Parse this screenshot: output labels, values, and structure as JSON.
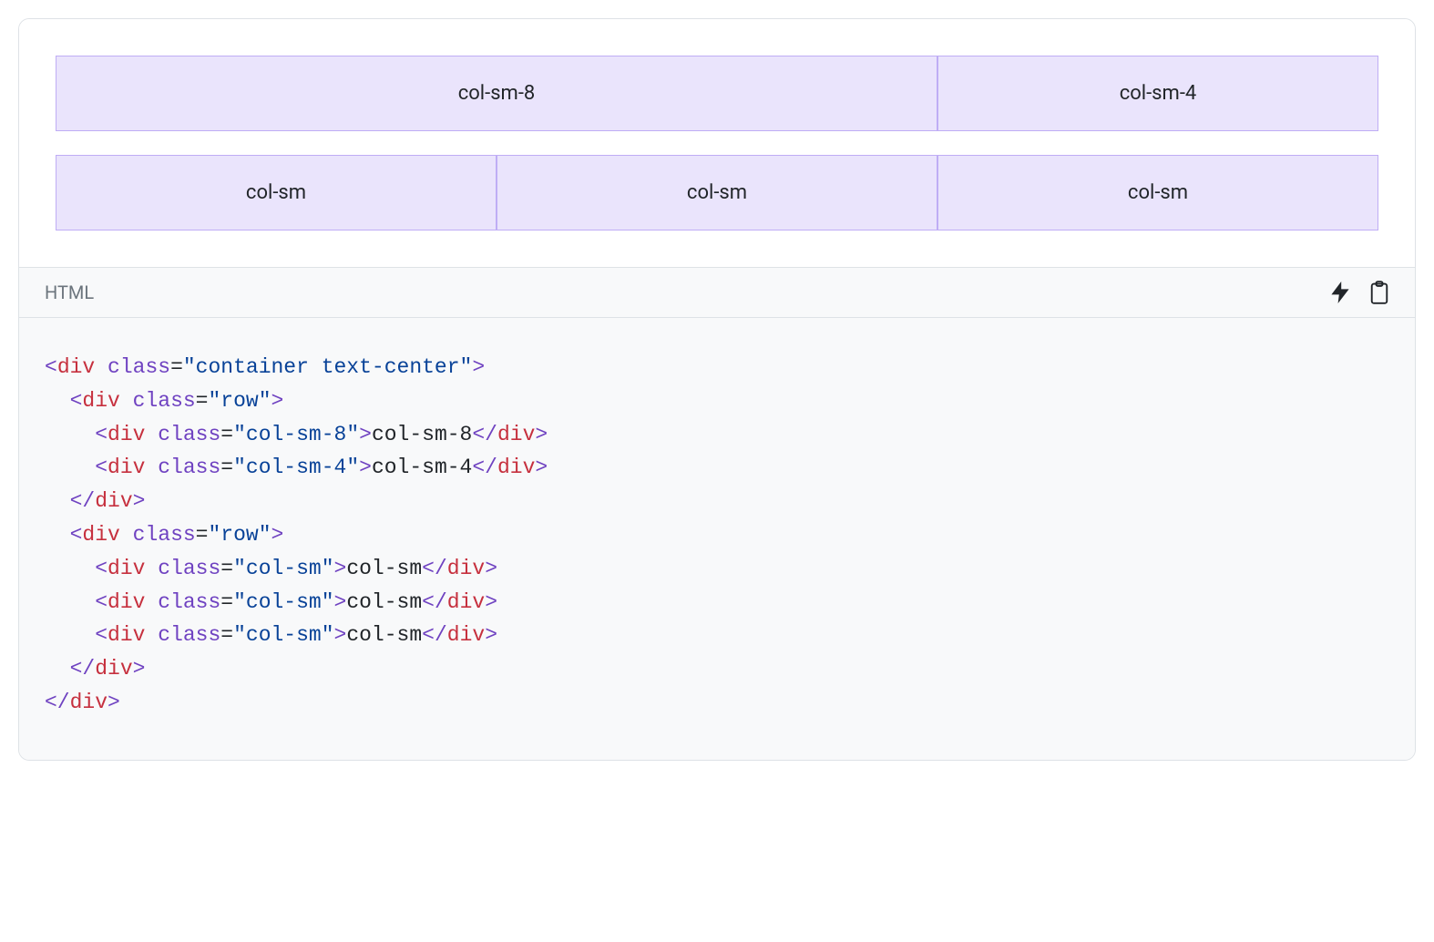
{
  "example": {
    "rows": [
      {
        "cols": [
          {
            "label": "col-sm-8",
            "width": "w8"
          },
          {
            "label": "col-sm-4",
            "width": "w4"
          }
        ]
      },
      {
        "cols": [
          {
            "label": "col-sm",
            "width": "weq"
          },
          {
            "label": "col-sm",
            "width": "weq"
          },
          {
            "label": "col-sm",
            "width": "weq"
          }
        ]
      }
    ]
  },
  "code_header": {
    "language_label": "HTML"
  },
  "code": {
    "lines": [
      {
        "indent": 0,
        "type": "open",
        "tag": "div",
        "attr": "class",
        "val": "container text-center"
      },
      {
        "indent": 1,
        "type": "open",
        "tag": "div",
        "attr": "class",
        "val": "row"
      },
      {
        "indent": 2,
        "type": "pair",
        "tag": "div",
        "attr": "class",
        "val": "col-sm-8",
        "text": "col-sm-8"
      },
      {
        "indent": 2,
        "type": "pair",
        "tag": "div",
        "attr": "class",
        "val": "col-sm-4",
        "text": "col-sm-4"
      },
      {
        "indent": 1,
        "type": "close",
        "tag": "div"
      },
      {
        "indent": 1,
        "type": "open",
        "tag": "div",
        "attr": "class",
        "val": "row"
      },
      {
        "indent": 2,
        "type": "pair",
        "tag": "div",
        "attr": "class",
        "val": "col-sm",
        "text": "col-sm"
      },
      {
        "indent": 2,
        "type": "pair",
        "tag": "div",
        "attr": "class",
        "val": "col-sm",
        "text": "col-sm"
      },
      {
        "indent": 2,
        "type": "pair",
        "tag": "div",
        "attr": "class",
        "val": "col-sm",
        "text": "col-sm"
      },
      {
        "indent": 1,
        "type": "close",
        "tag": "div"
      },
      {
        "indent": 0,
        "type": "close",
        "tag": "div"
      }
    ]
  }
}
